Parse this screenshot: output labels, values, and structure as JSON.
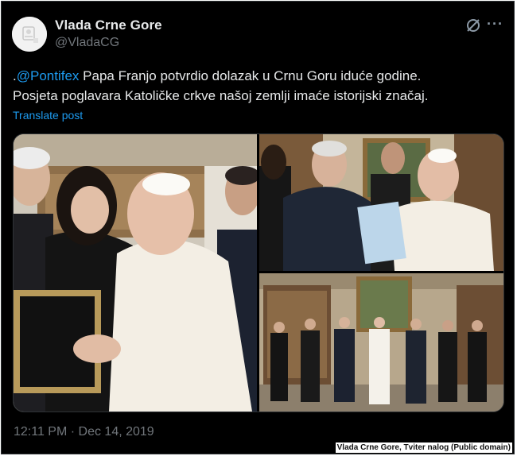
{
  "author": {
    "display_name": "Vlada Crne Gore",
    "handle": "@VladaCG",
    "avatar": "government-logo-avatar"
  },
  "header_icons": {
    "grok": "grok-slash-icon",
    "more": "more-horizontal-icon",
    "more_glyph": "···"
  },
  "tweet": {
    "prefix": ".",
    "mention": "@Pontifex",
    "line1_rest": " Papa Franjo potvrdio dolazak u Crnu Goru iduće godine.",
    "line2": "Posjeta poglavara Katoličke crkve našoj zemlji imaće istorijski značaj."
  },
  "translate_label": "Translate post",
  "media": {
    "photos": [
      "pope-greeting-woman-with-framed-gift",
      "pope-receiving-document-from-official",
      "group-photo-in-papal-library"
    ]
  },
  "timestamp": "12:11 PM · Dec 14, 2019",
  "credit": "Vlada Crne Gore, Tviter nalog (Public domain)",
  "colors": {
    "background": "#000000",
    "text": "#e7e9ea",
    "secondary": "#71767b",
    "link": "#1d9bf0",
    "border": "#2f3336"
  }
}
